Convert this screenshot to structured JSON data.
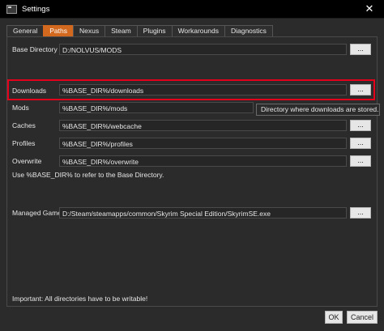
{
  "window": {
    "title": "Settings",
    "close_glyph": "✕"
  },
  "tabs": [
    {
      "label": "General",
      "active": false
    },
    {
      "label": "Paths",
      "active": true
    },
    {
      "label": "Nexus",
      "active": false
    },
    {
      "label": "Steam",
      "active": false
    },
    {
      "label": "Plugins",
      "active": false
    },
    {
      "label": "Workarounds",
      "active": false
    },
    {
      "label": "Diagnostics",
      "active": false
    }
  ],
  "paths": {
    "base_directory": {
      "label": "Base Directory",
      "value": "D:/NOLVUS/MODS"
    },
    "downloads": {
      "label": "Downloads",
      "value": "%BASE_DIR%/downloads"
    },
    "mods": {
      "label": "Mods",
      "value": "%BASE_DIR%/mods"
    },
    "caches": {
      "label": "Caches",
      "value": "%BASE_DIR%/webcache"
    },
    "profiles": {
      "label": "Profiles",
      "value": "%BASE_DIR%/profiles"
    },
    "overwrite": {
      "label": "Overwrite",
      "value": "%BASE_DIR%/overwrite"
    },
    "managed_game": {
      "label": "Managed Game",
      "value": "D:/Steam/steamapps/common/Skyrim Special Edition/SkyrimSE.exe"
    },
    "browse_label": "...",
    "base_dir_hint": "Use %BASE_DIR% to refer to the Base Directory.",
    "tooltip": "Directory where downloads are stored."
  },
  "footer": {
    "important_note": "Important: All directories have to be writable!",
    "ok_label": "OK",
    "cancel_label": "Cancel"
  },
  "colors": {
    "accent": "#d2691e",
    "highlight": "#e3001b"
  }
}
